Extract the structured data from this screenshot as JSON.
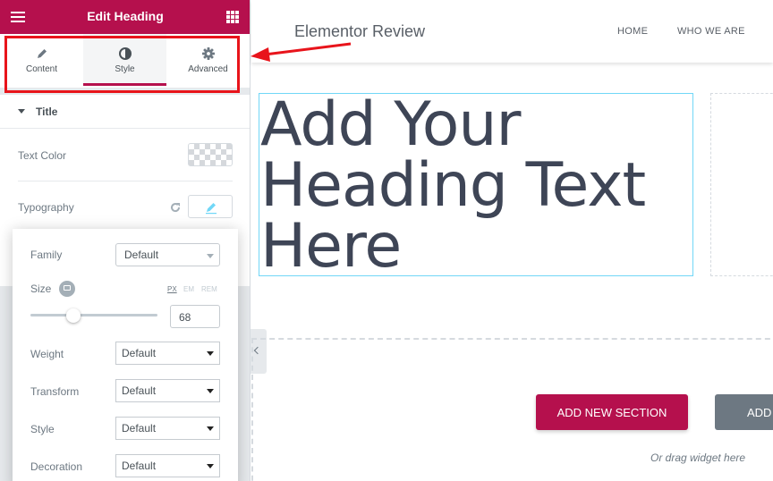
{
  "panel": {
    "header_title": "Edit Heading",
    "tabs": [
      {
        "label": "Content",
        "icon": "pencil-icon"
      },
      {
        "label": "Style",
        "icon": "contrast-icon"
      },
      {
        "label": "Advanced",
        "icon": "gear-icon"
      }
    ],
    "section_title": "Title",
    "text_color_label": "Text Color",
    "typography_label": "Typography"
  },
  "typography": {
    "family_label": "Family",
    "family_value": "Default",
    "size_label": "Size",
    "units": [
      "PX",
      "EM",
      "REM"
    ],
    "size_value": "68",
    "size_slider_fraction": 0.34,
    "weight_label": "Weight",
    "weight_value": "Default",
    "transform_label": "Transform",
    "transform_value": "Default",
    "style_label": "Style",
    "style_value": "Default",
    "decoration_label": "Decoration",
    "decoration_value": "Default"
  },
  "site": {
    "title": "Elementor Review",
    "nav": [
      "HOME",
      "WHO WE ARE"
    ]
  },
  "canvas": {
    "heading_text": "Add Your Heading Text Here",
    "add_section_label": "ADD NEW SECTION",
    "add_template_label": "ADD",
    "drag_hint": "Or drag widget here"
  },
  "colors": {
    "accent": "#b5104d",
    "annotation": "#e8141b",
    "heading": "#3e4556"
  }
}
